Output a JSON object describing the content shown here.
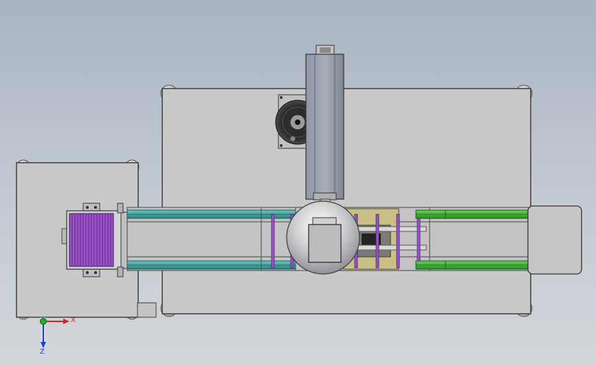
{
  "view": {
    "title": "",
    "triad": {
      "x_label": "X",
      "z_label": "Z"
    }
  },
  "colors": {
    "background_top": "#a9b4c3",
    "background_bottom": "#d3d6da",
    "plate": "#c8c8c8",
    "plate_edge": "#3c3c3c",
    "teal_rail": "#3d9c98",
    "green_rail": "#3fb33a",
    "yellow_block": "#c8c084",
    "purple_part": "#9a52c6",
    "axis_x": "#d42222",
    "axis_y": "#1fae2a",
    "axis_z": "#1b3fd6"
  }
}
